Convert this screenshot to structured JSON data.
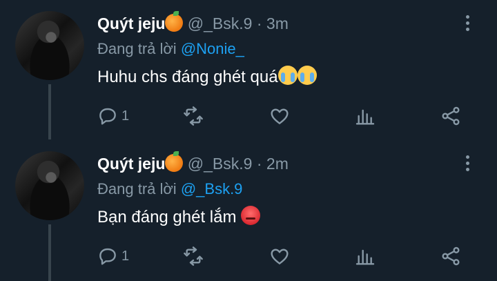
{
  "tweets": [
    {
      "name": "Quýt jeju",
      "handle": "@_Bsk.9",
      "separator": "·",
      "time": "3m",
      "reply_prefix": "Đang trả lời",
      "reply_to": "@Nonie_",
      "text": "Huhu chs đáng ghét quá",
      "emoji": [
        "crying-face",
        "crying-face"
      ],
      "reply_count": "1"
    },
    {
      "name": "Quýt jeju",
      "handle": "@_Bsk.9",
      "separator": "·",
      "time": "2m",
      "reply_prefix": "Đang trả lời",
      "reply_to": "@_Bsk.9",
      "text": "Bạn đáng ghét lắm",
      "emoji": [
        "angry-face"
      ],
      "reply_count": "1"
    }
  ],
  "colors": {
    "background": "#15202b",
    "muted": "#8899a6",
    "link": "#1da1f2",
    "divider": "#38444d"
  },
  "icons": [
    "more-vertical-icon",
    "reply-icon",
    "retweet-icon",
    "like-icon",
    "analytics-icon",
    "share-icon"
  ]
}
